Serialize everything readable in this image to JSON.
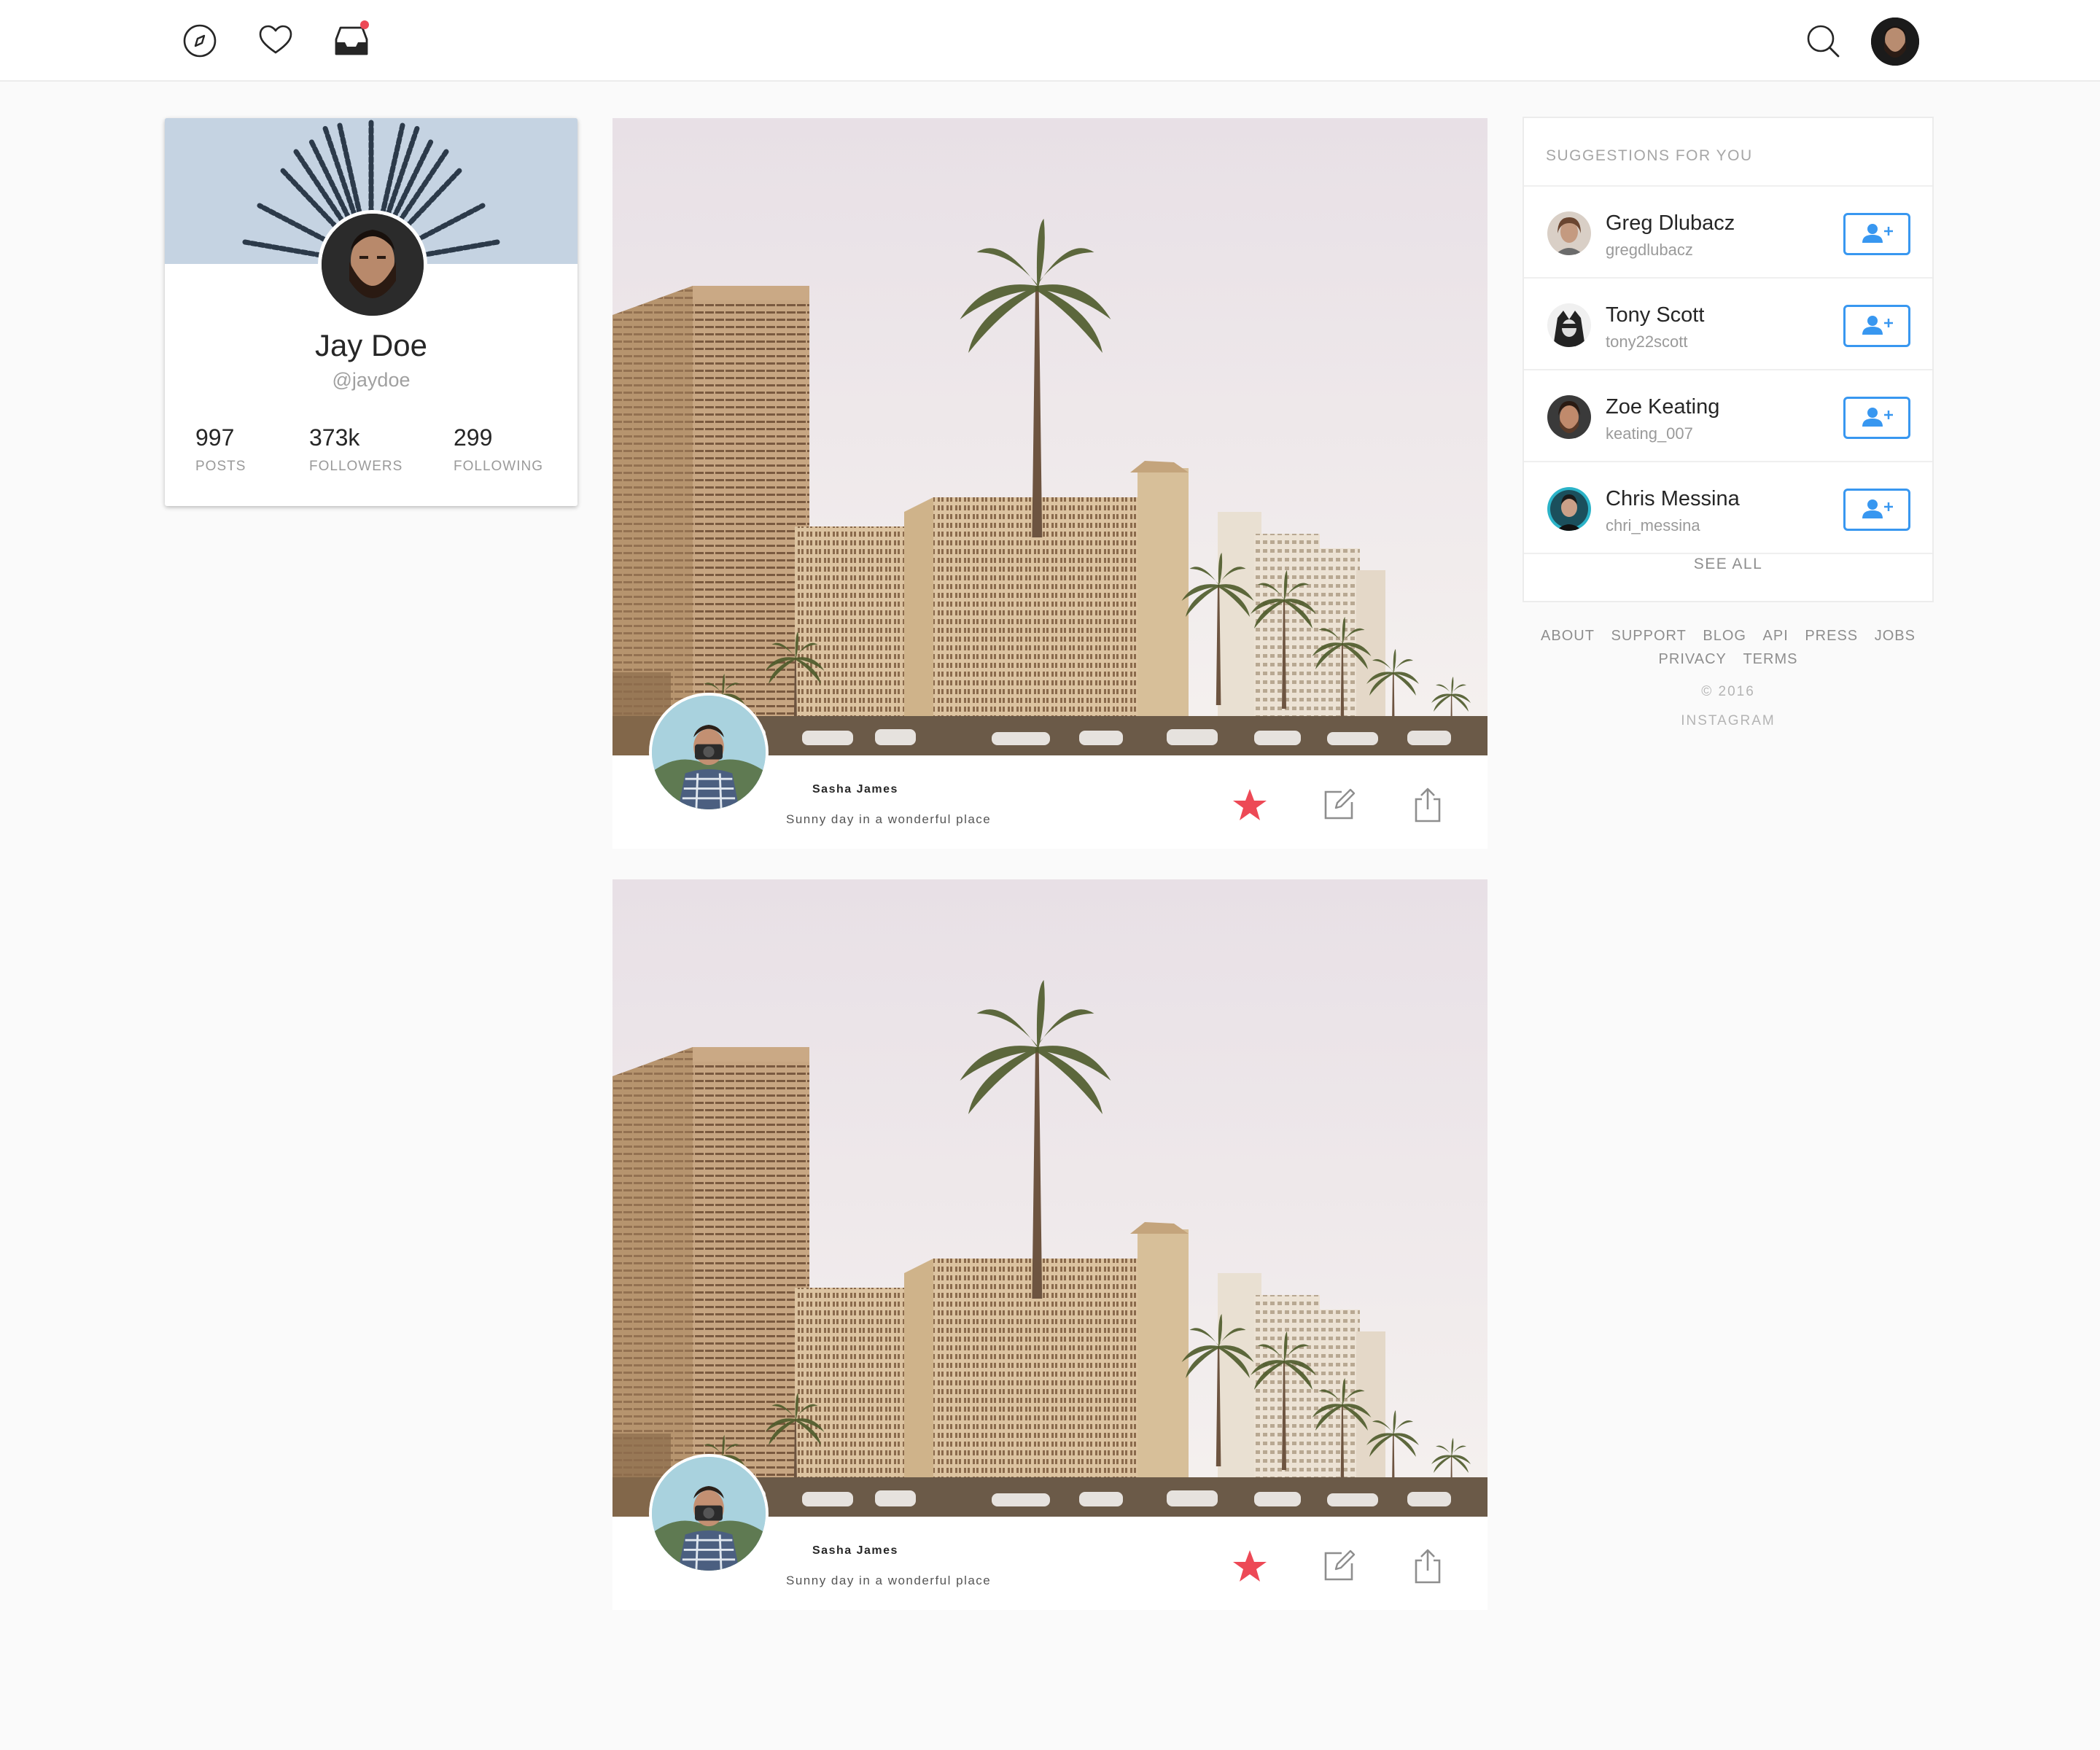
{
  "nav": {
    "icons": [
      "compass-icon",
      "heart-icon",
      "inbox-icon",
      "search-icon"
    ],
    "notification_color": "#ed4956"
  },
  "profile": {
    "name": "Jay Doe",
    "handle": "@jaydoe",
    "stats": [
      {
        "value": "997",
        "label": "POSTS"
      },
      {
        "value": "373k",
        "label": "FOLLOWERS"
      },
      {
        "value": "299",
        "label": "FOLLOWING"
      }
    ]
  },
  "posts": [
    {
      "author": "Sasha James",
      "caption": "Sunny day in a wonderful place",
      "starred": true
    },
    {
      "author": "Sasha James",
      "caption": "Sunny day in a wonderful place",
      "starred": true
    }
  ],
  "suggestions": {
    "title": "SUGGESTIONS FOR YOU",
    "items": [
      {
        "name": "Greg Dlubacz",
        "username": "gregdlubacz"
      },
      {
        "name": "Tony Scott",
        "username": "tony22scott"
      },
      {
        "name": "Zoe Keating",
        "username": "keating_007"
      },
      {
        "name": "Chris Messina",
        "username": "chri_messina"
      }
    ],
    "see_all": "SEE ALL"
  },
  "footer": {
    "links": [
      "ABOUT",
      "SUPPORT",
      "BLOG",
      "API",
      "PRESS",
      "JOBS",
      "PRIVACY",
      "TERMS"
    ],
    "copyright": "© 2016",
    "brand": "INSTAGRAM"
  },
  "colors": {
    "accent": "#3897f0",
    "star": "#ed4956"
  }
}
